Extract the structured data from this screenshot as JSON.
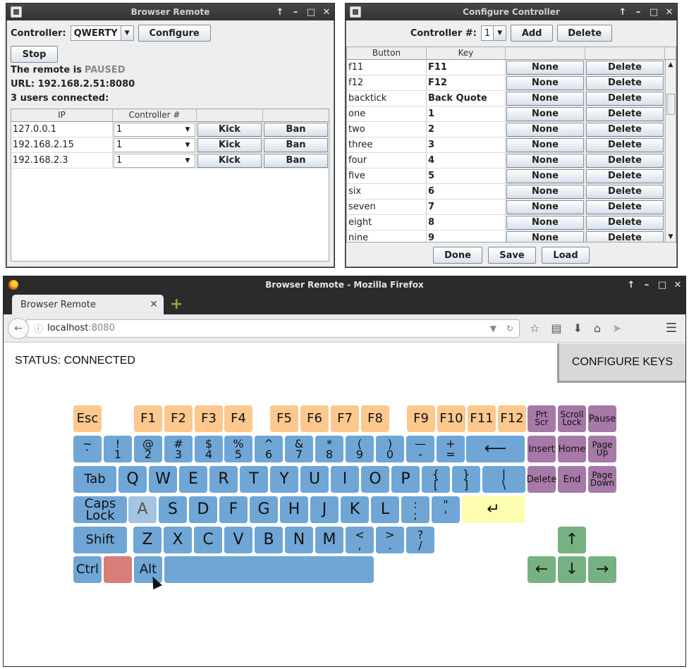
{
  "browser_remote": {
    "title": "Browser Remote",
    "controller_label": "Controller:",
    "controller_value": "QWERTY",
    "configure_label": "Configure",
    "stop_label": "Stop",
    "status_prefix": "The remote is",
    "status_value": "PAUSED",
    "url_text": "URL: 192.168.2.51:8080",
    "users_text": "3 users connected:",
    "table": {
      "headers": [
        "IP",
        "Controller #",
        "",
        ""
      ],
      "rows": [
        {
          "ip": "127.0.0.1",
          "controller": "1",
          "kick": "Kick",
          "ban": "Ban"
        },
        {
          "ip": "192.168.2.15",
          "controller": "1",
          "kick": "Kick",
          "ban": "Ban"
        },
        {
          "ip": "192.168.2.3",
          "controller": "1",
          "kick": "Kick",
          "ban": "Ban"
        }
      ]
    }
  },
  "configure_controller": {
    "title": "Configure Controller",
    "controller_num_label": "Controller #:",
    "controller_num_value": "1",
    "add_label": "Add",
    "delete_label": "Delete",
    "headers": [
      "Button",
      "Key",
      "",
      ""
    ],
    "rows": [
      {
        "button": "f11",
        "key": "F11",
        "none": "None",
        "del": "Delete"
      },
      {
        "button": "f12",
        "key": "F12",
        "none": "None",
        "del": "Delete"
      },
      {
        "button": "backtick",
        "key": "Back Quote",
        "none": "None",
        "del": "Delete"
      },
      {
        "button": "one",
        "key": "1",
        "none": "None",
        "del": "Delete"
      },
      {
        "button": "two",
        "key": "2",
        "none": "None",
        "del": "Delete"
      },
      {
        "button": "three",
        "key": "3",
        "none": "None",
        "del": "Delete"
      },
      {
        "button": "four",
        "key": "4",
        "none": "None",
        "del": "Delete"
      },
      {
        "button": "five",
        "key": "5",
        "none": "None",
        "del": "Delete"
      },
      {
        "button": "six",
        "key": "6",
        "none": "None",
        "del": "Delete"
      },
      {
        "button": "seven",
        "key": "7",
        "none": "None",
        "del": "Delete"
      },
      {
        "button": "eight",
        "key": "8",
        "none": "None",
        "del": "Delete"
      },
      {
        "button": "nine",
        "key": "9",
        "none": "None",
        "del": "Delete"
      }
    ],
    "done_label": "Done",
    "save_label": "Save",
    "load_label": "Load"
  },
  "firefox": {
    "title": "Browser Remote - Mozilla Firefox",
    "tab_title": "Browser Remote",
    "url_host": "localhost",
    "url_port": ":8080",
    "page": {
      "status": "STATUS: CONNECTED",
      "configure_keys": "CONFIGURE KEYS"
    }
  },
  "keyboard": {
    "colors": {
      "main": "#6fa6d6",
      "function": "#fcc88e",
      "system": "#a679a8",
      "arrows": "#77b181",
      "enter": "#fdfdaf",
      "special": "#d87d7a",
      "hover": "#a5c4e2"
    },
    "rows": [
      {
        "keys": [
          {
            "id": "esc",
            "t": "Esc",
            "c": "orange"
          },
          {
            "id": "f1",
            "t": "F1",
            "c": "orange"
          },
          {
            "id": "f2",
            "t": "F2",
            "c": "orange"
          },
          {
            "id": "f3",
            "t": "F3",
            "c": "orange"
          },
          {
            "id": "f4",
            "t": "F4",
            "c": "orange"
          },
          {
            "id": "f5",
            "t": "F5",
            "c": "orange"
          },
          {
            "id": "f6",
            "t": "F6",
            "c": "orange"
          },
          {
            "id": "f7",
            "t": "F7",
            "c": "orange"
          },
          {
            "id": "f8",
            "t": "F8",
            "c": "orange"
          },
          {
            "id": "f9",
            "t": "F9",
            "c": "orange"
          },
          {
            "id": "f10",
            "t": "F10",
            "c": "orange"
          },
          {
            "id": "f11",
            "t": "F11",
            "c": "orange"
          },
          {
            "id": "f12",
            "t": "F12",
            "c": "orange"
          },
          {
            "id": "prtscr",
            "t": "Prt\nScr",
            "c": "purple"
          },
          {
            "id": "scrolllock",
            "t": "Scroll\nLock",
            "c": "purple"
          },
          {
            "id": "pause",
            "t": "Pause",
            "c": "purple"
          }
        ]
      },
      {
        "keys": [
          {
            "id": "backtick",
            "t": "~\n`",
            "c": "blue"
          },
          {
            "id": "1",
            "t": "!\n1",
            "c": "blue"
          },
          {
            "id": "2",
            "t": "@\n2",
            "c": "blue"
          },
          {
            "id": "3",
            "t": "#\n3",
            "c": "blue"
          },
          {
            "id": "4",
            "t": "$\n4",
            "c": "blue"
          },
          {
            "id": "5",
            "t": "%\n5",
            "c": "blue"
          },
          {
            "id": "6",
            "t": "^\n6",
            "c": "blue"
          },
          {
            "id": "7",
            "t": "&\n7",
            "c": "blue"
          },
          {
            "id": "8",
            "t": "*\n8",
            "c": "blue"
          },
          {
            "id": "9",
            "t": "(\n9",
            "c": "blue"
          },
          {
            "id": "0",
            "t": ")\n0",
            "c": "blue"
          },
          {
            "id": "minus",
            "t": "—\n-",
            "c": "blue"
          },
          {
            "id": "equals",
            "t": "+\n=",
            "c": "blue"
          },
          {
            "id": "backspace",
            "t": "⟵",
            "c": "blue"
          },
          {
            "id": "insert",
            "t": "Insert",
            "c": "purple"
          },
          {
            "id": "home",
            "t": "Home",
            "c": "purple"
          },
          {
            "id": "pageup",
            "t": "Page\nUp",
            "c": "purple"
          }
        ]
      },
      {
        "keys": [
          {
            "id": "tab",
            "t": "Tab",
            "c": "blue"
          },
          {
            "id": "q",
            "t": "Q",
            "c": "blue"
          },
          {
            "id": "w",
            "t": "W",
            "c": "blue"
          },
          {
            "id": "e",
            "t": "E",
            "c": "blue"
          },
          {
            "id": "r",
            "t": "R",
            "c": "blue"
          },
          {
            "id": "t",
            "t": "T",
            "c": "blue"
          },
          {
            "id": "y",
            "t": "Y",
            "c": "blue"
          },
          {
            "id": "u",
            "t": "U",
            "c": "blue"
          },
          {
            "id": "i",
            "t": "I",
            "c": "blue"
          },
          {
            "id": "o",
            "t": "O",
            "c": "blue"
          },
          {
            "id": "p",
            "t": "P",
            "c": "blue"
          },
          {
            "id": "lbracket",
            "t": "{\n[",
            "c": "blue"
          },
          {
            "id": "rbracket",
            "t": "}\n]",
            "c": "blue"
          },
          {
            "id": "backslash",
            "t": "|\n\\",
            "c": "blue"
          },
          {
            "id": "delete",
            "t": "Delete",
            "c": "purple"
          },
          {
            "id": "end",
            "t": "End",
            "c": "purple"
          },
          {
            "id": "pagedown",
            "t": "Page\nDown",
            "c": "purple"
          }
        ]
      },
      {
        "keys": [
          {
            "id": "capslock",
            "t": "Caps\nLock",
            "c": "blue"
          },
          {
            "id": "a",
            "t": "A",
            "c": "hl"
          },
          {
            "id": "s",
            "t": "S",
            "c": "blue"
          },
          {
            "id": "d",
            "t": "D",
            "c": "blue"
          },
          {
            "id": "f",
            "t": "F",
            "c": "blue"
          },
          {
            "id": "g",
            "t": "G",
            "c": "blue"
          },
          {
            "id": "h",
            "t": "H",
            "c": "blue"
          },
          {
            "id": "j",
            "t": "J",
            "c": "blue"
          },
          {
            "id": "k",
            "t": "K",
            "c": "blue"
          },
          {
            "id": "l",
            "t": "L",
            "c": "blue"
          },
          {
            "id": "semicolon",
            "t": ":\n;",
            "c": "blue"
          },
          {
            "id": "quote",
            "t": "\"\n'",
            "c": "blue"
          },
          {
            "id": "enter",
            "t": "↵",
            "c": "yellow"
          }
        ]
      },
      {
        "keys": [
          {
            "id": "shift",
            "t": "Shift",
            "c": "blue"
          },
          {
            "id": "z",
            "t": "Z",
            "c": "blue"
          },
          {
            "id": "x",
            "t": "X",
            "c": "blue"
          },
          {
            "id": "c",
            "t": "C",
            "c": "blue"
          },
          {
            "id": "v",
            "t": "V",
            "c": "blue"
          },
          {
            "id": "b",
            "t": "B",
            "c": "blue"
          },
          {
            "id": "n",
            "t": "N",
            "c": "blue"
          },
          {
            "id": "m",
            "t": "M",
            "c": "blue"
          },
          {
            "id": "comma",
            "t": "<\n,",
            "c": "blue"
          },
          {
            "id": "period",
            "t": ">\n.",
            "c": "blue"
          },
          {
            "id": "slash",
            "t": "?\n/",
            "c": "blue"
          },
          {
            "id": "up",
            "t": "↑",
            "c": "green"
          }
        ]
      },
      {
        "keys": [
          {
            "id": "ctrl",
            "t": "Ctrl",
            "c": "blue"
          },
          {
            "id": "meta",
            "t": "",
            "c": "red"
          },
          {
            "id": "alt",
            "t": "Alt",
            "c": "blue"
          },
          {
            "id": "space",
            "t": "",
            "c": "blue"
          },
          {
            "id": "left",
            "t": "←",
            "c": "green"
          },
          {
            "id": "down",
            "t": "↓",
            "c": "green"
          },
          {
            "id": "right",
            "t": "→",
            "c": "green"
          }
        ]
      }
    ]
  }
}
